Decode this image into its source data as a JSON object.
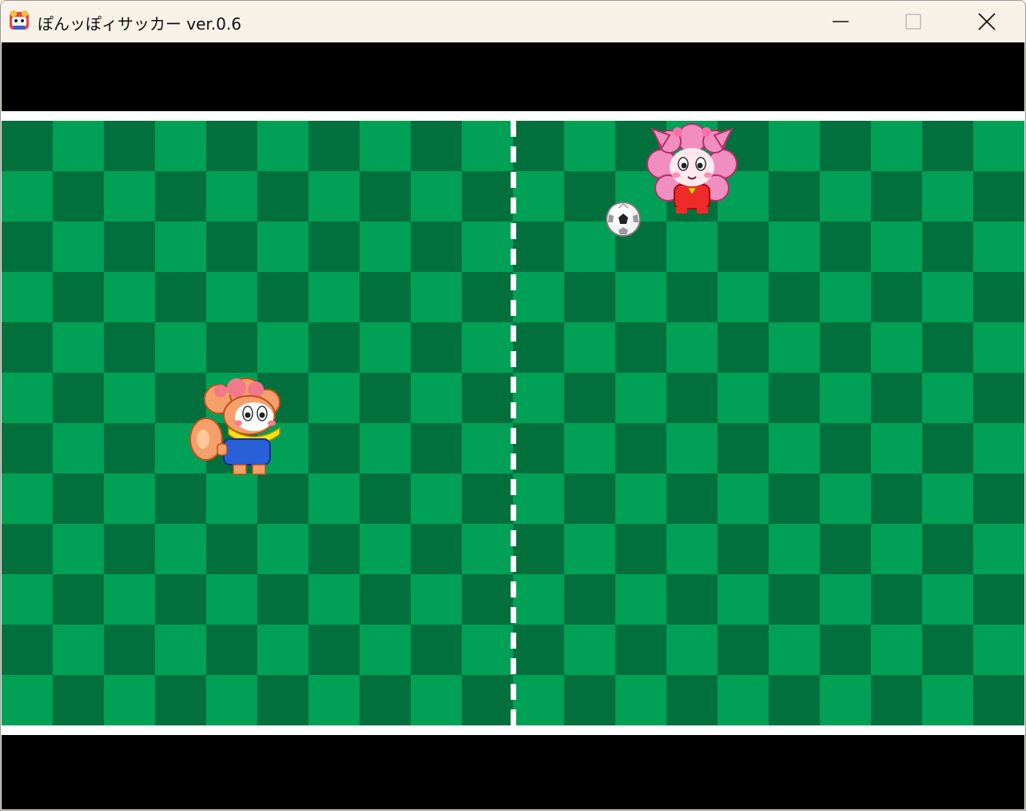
{
  "window": {
    "title": "ぽんッぽィサッカー ver.0.6",
    "icon": "pompompurin-app-icon",
    "controls": {
      "minimize_icon": "minimize-icon",
      "maximize_icon": "maximize-icon",
      "close_icon": "close-icon"
    }
  },
  "game": {
    "field": {
      "columns": 20,
      "rows": 12,
      "dark_green": "#01703c",
      "light_green": "#00a057",
      "line_color": "#ffffff",
      "border_color": "#000000"
    },
    "players": [
      {
        "name": "orange-tanuki-player",
        "team": "left",
        "color": "#f5a06a"
      },
      {
        "name": "pink-cat-player",
        "team": "right",
        "color": "#f08fbf"
      }
    ],
    "ball": {
      "name": "soccer-ball"
    }
  }
}
